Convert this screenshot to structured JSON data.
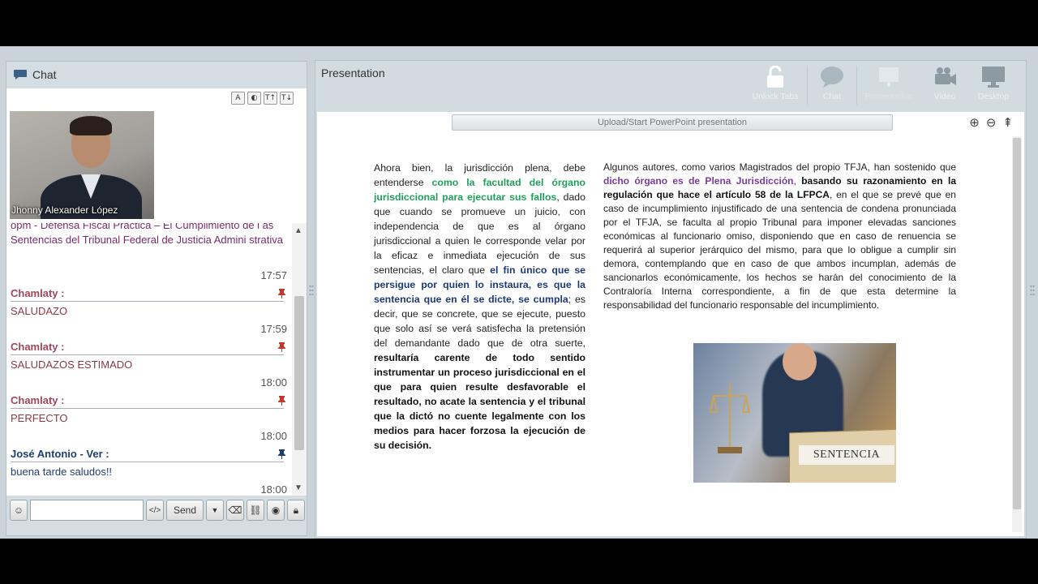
{
  "chat": {
    "title": "Chat",
    "video_name": "Jhonny Alexander López",
    "font_tools": [
      "A",
      "◐",
      "T↑",
      "T↓"
    ],
    "cut_text": "opm - Defensa Fiscal Práctica – El Cumplimiento de l as Sentencias del Tribunal Federal de Justicia Admini strativa",
    "cut_time": "17:57",
    "messages": [
      {
        "author": "Chamlaty :",
        "text": "SALUDAZO",
        "time": "17:59"
      },
      {
        "author": "Chamlaty :",
        "text": "SALUDAZOS ESTIMADO",
        "time": "18:00"
      },
      {
        "author": "Chamlaty :",
        "text": "PERFECTO",
        "time": "18:00"
      },
      {
        "author": "José Antonio - Ver :",
        "text": "buena tarde saludos!!",
        "time": "18:00"
      }
    ],
    "send_label": "Send"
  },
  "presentation": {
    "title": "Presentation",
    "toolbar": [
      {
        "label": "Unlock Tabs",
        "icon": "lock-open-icon"
      },
      {
        "label": "Chat",
        "icon": "chat-bubble-icon"
      },
      {
        "label": "Presentation",
        "icon": "presentation-icon"
      },
      {
        "label": "Video",
        "icon": "video-camera-icon"
      },
      {
        "label": "Desktop",
        "icon": "monitor-icon"
      }
    ],
    "upload_label": "Upload/Start PowerPoint presentation",
    "left_col": {
      "p1": "Ahora bien, la jurisdicción plena, debe entenderse ",
      "green": "como la facultad del órgano jurisdiccional para ejecutar sus fallos",
      "p2": ", dado que cuando se promueve un juicio, con independencia de que es al órgano jurisdiccional a quien le corresponde velar por la eficaz e inmediata ejecución de sus sentencias, el claro que ",
      "blue": "el fin único que se persigue por quien lo instaura, es que la sentencia que en él se dicte, se cumpla",
      "p3": "; es decir, que se concrete, que se ejecute, puesto que solo así se verá satisfecha la pretensión del demandante dado que de otra suerte, ",
      "bold": "resultaría carente de todo sentido instrumentar un proceso jurisdiccional en el que para quien resulte desfavorable el resultado, no acate la sentencia y el tribunal que la dictó no cuente legalmente con los medios para hacer forzosa la ejecución de su decisión."
    },
    "right_col": {
      "p1": "Algunos autores, como varios Magistrados del propio TFJA, han sostenido que ",
      "purple": "dicho órgano es de Plena Jurisdicción",
      "p2": ", ",
      "bold": "basando su razonamiento en la regulación que hace el artículo 58 de la LFPCA",
      "p3": ", en el que se prevé que en caso de incumplimiento injustificado de una sentencia de condena pronunciada por el TFJA, se faculta al propio Tribunal para imponer elevadas sanciones económicas al funcionario omiso, disponiendo que en caso de renuencia se requerirá al superior jerárquico del mismo, para que lo obligue a cumplir sin demora, contemplando que en caso de que ambos incumplan, además de sancionarlos económicamente, los hechos se harán del conocimiento de la Contraloría Interna correspondiente, a fin de que esta determine la responsabilidad del funcionario responsable del incumplimiento."
    },
    "image_label": "SENTENCIA"
  }
}
